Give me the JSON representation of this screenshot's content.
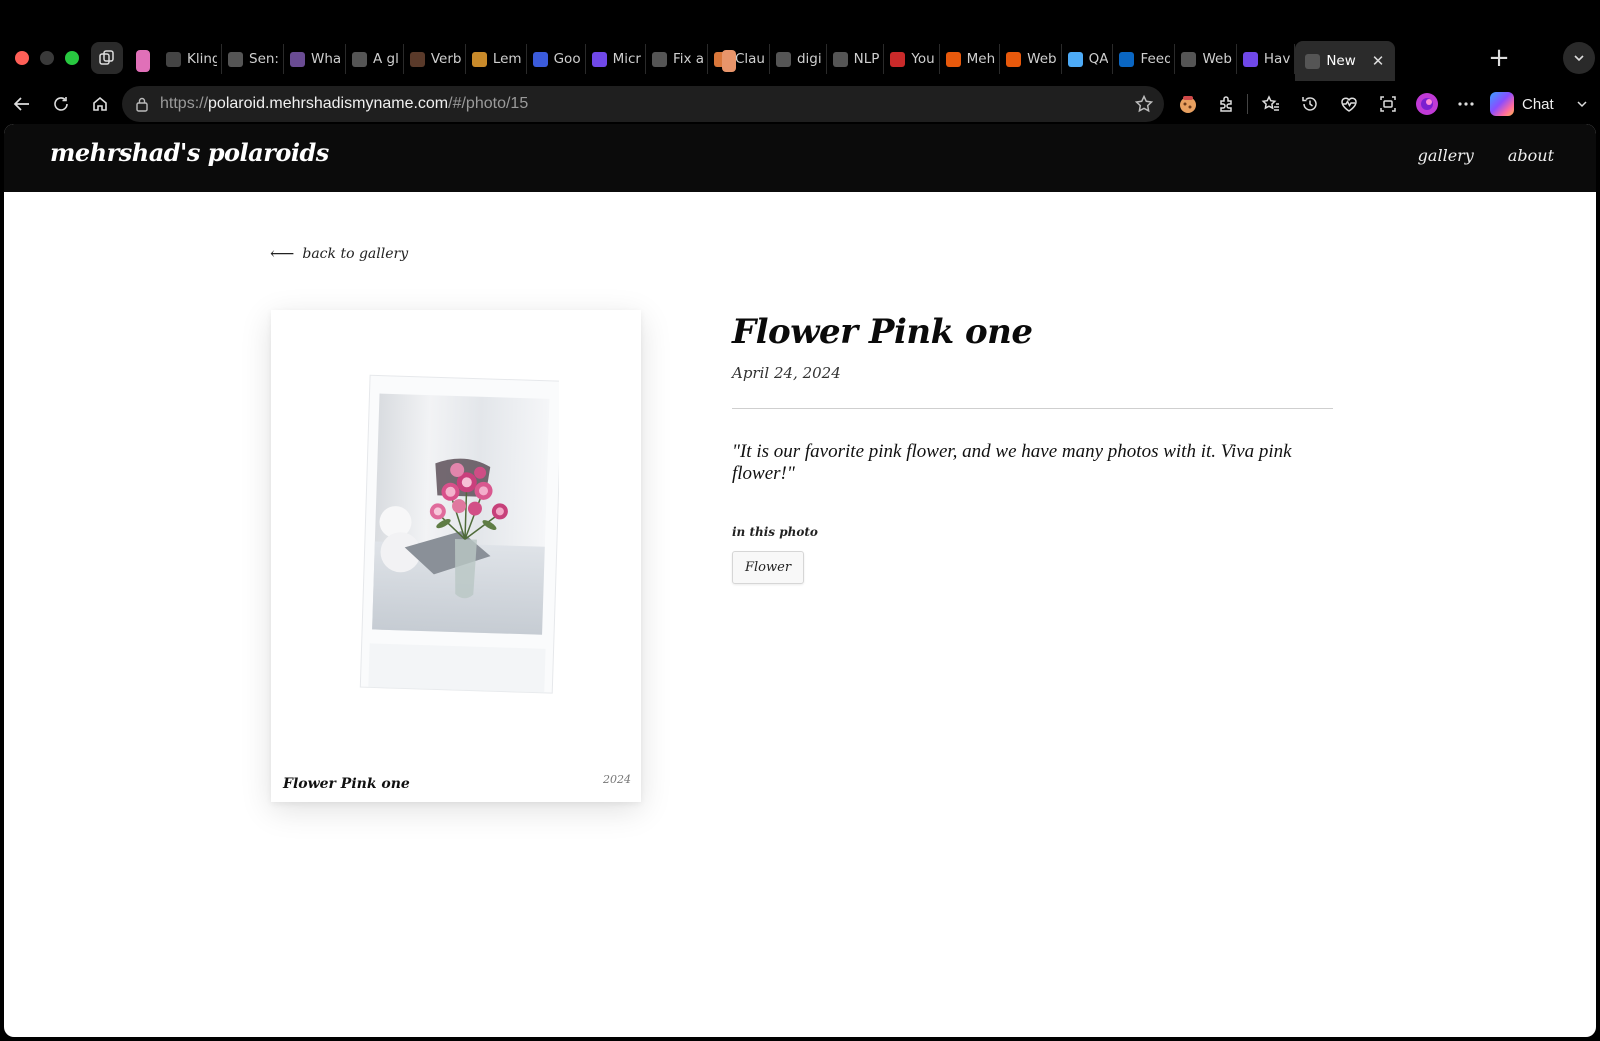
{
  "browser": {
    "tabs": [
      {
        "title": "Kling",
        "favicon_color": "#444"
      },
      {
        "title": "Sen:",
        "favicon_color": "#555"
      },
      {
        "title": "Wha",
        "favicon_color": "#6a4c93"
      },
      {
        "title": "A gl",
        "favicon_color": "#555"
      },
      {
        "title": "Verb",
        "favicon_color": "#5a3a2a"
      },
      {
        "title": "Lem",
        "favicon_color": "#c98a2a"
      },
      {
        "title": "Goo",
        "favicon_color": "#3b5bdb"
      },
      {
        "title": "Micr",
        "favicon_color": "#7048e8"
      },
      {
        "title": "Fix a",
        "favicon_color": "#555"
      },
      {
        "title": "Clau",
        "favicon_color": "#d9773b"
      },
      {
        "title": "digi",
        "favicon_color": "#555"
      },
      {
        "title": "NLP",
        "favicon_color": "#555"
      },
      {
        "title": "You",
        "favicon_color": "#c92a2a"
      },
      {
        "title": "Meh",
        "favicon_color": "#e8590c"
      },
      {
        "title": "Web",
        "favicon_color": "#e8590c"
      },
      {
        "title": "QA",
        "favicon_color": "#4dabf7"
      },
      {
        "title": "Feed",
        "favicon_color": "#0a66c2"
      },
      {
        "title": "Web",
        "favicon_color": "#555"
      },
      {
        "title": "Hav",
        "favicon_color": "#7048e8"
      },
      {
        "title": "New",
        "favicon_color": "#555"
      }
    ],
    "active_tab_close": "✕",
    "url_scheme": "https://",
    "url_host": "polaroid.mehrshadismyname.com",
    "url_path": "/#/photo/15",
    "chat_label": "Chat",
    "colors": {
      "pin_tab_1": "#e070b8",
      "pin_tab_2": "#e8956b"
    }
  },
  "site": {
    "logo": "mehrshad's polaroids",
    "nav": {
      "gallery": "gallery",
      "about": "about"
    }
  },
  "page": {
    "back_label": "back to gallery",
    "photo": {
      "caption": "Flower Pink one",
      "year": "2024"
    },
    "title": "Flower Pink one",
    "date": "April 24, 2024",
    "quote": "\"It is our favorite pink flower, and we have many photos with it. Viva pink flower!\"",
    "tags_label": "in this photo",
    "tags": [
      "Flower"
    ]
  }
}
